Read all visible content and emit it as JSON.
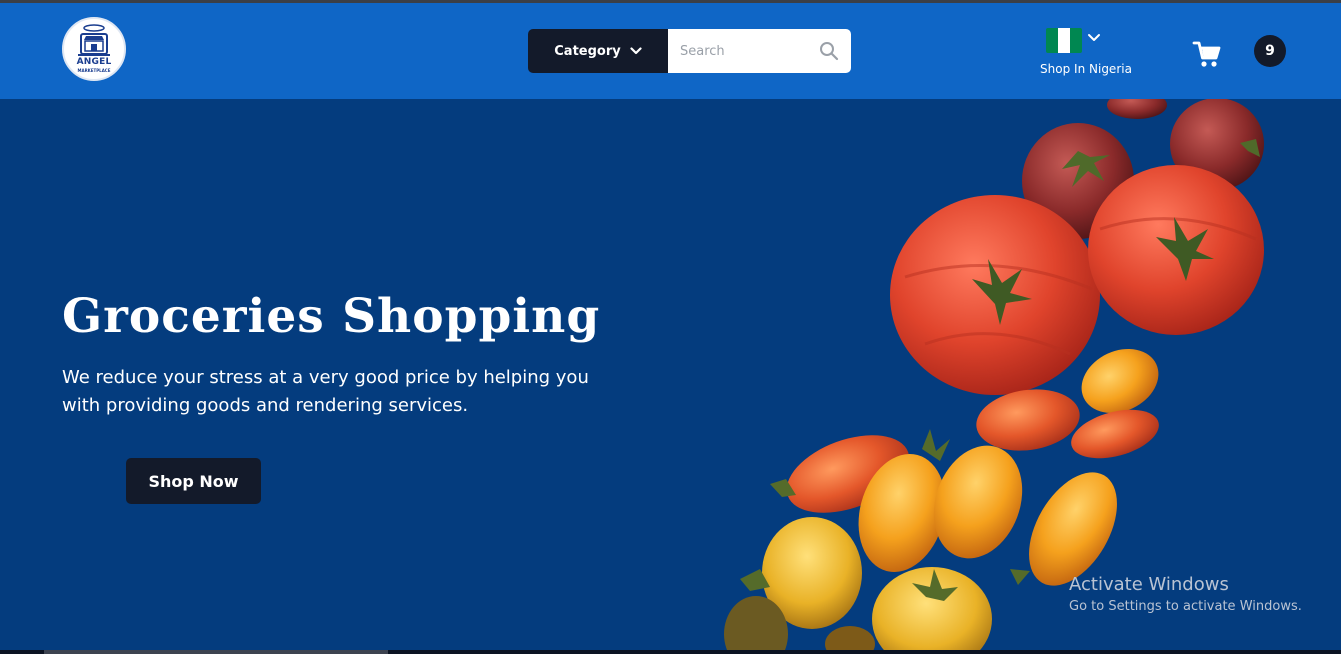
{
  "header": {
    "logo": {
      "icon": "storefront-icon",
      "name": "ANGEL",
      "subtitle": "MARKETPLACE"
    },
    "category_label": "Category",
    "search": {
      "placeholder": "Search",
      "value": ""
    },
    "country": {
      "label": "Shop In Nigeria",
      "flag": "nigeria-flag",
      "flag_colors": [
        "#008751",
        "#ffffff",
        "#008751"
      ]
    },
    "cart": {
      "icon": "cart-icon",
      "count": "9"
    }
  },
  "hero": {
    "title": "Groceries Shopping",
    "subtitle": "We reduce your stress at a very good price by helping you with providing goods and rendering services.",
    "cta_label": "Shop Now",
    "image": "tomatoes-photo"
  },
  "watermark": {
    "title": "Activate Windows",
    "subtitle": "Go to Settings to activate Windows."
  },
  "colors": {
    "header_bg": "#0f66c6",
    "hero_bg": "#043c7e",
    "dark_button": "#131a2a"
  }
}
